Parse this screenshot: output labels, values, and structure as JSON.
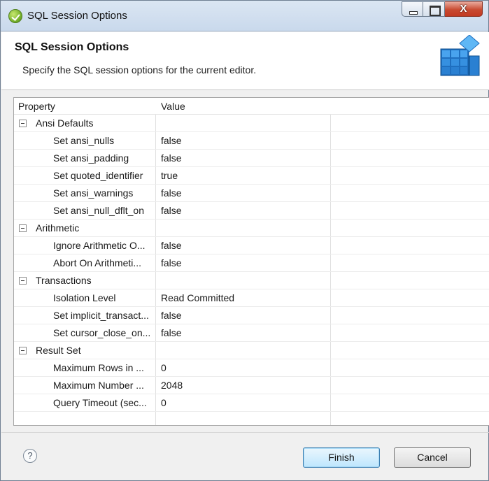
{
  "window": {
    "title": "SQL Session Options",
    "close_glyph": "X"
  },
  "header": {
    "title": "SQL Session Options",
    "description": "Specify the SQL session options for the current editor."
  },
  "table": {
    "columns": [
      "Property",
      "Value"
    ],
    "rows": [
      {
        "type": "group",
        "property": "Ansi Defaults",
        "value": ""
      },
      {
        "type": "item",
        "property": "Set ansi_nulls",
        "value": "false"
      },
      {
        "type": "item",
        "property": "Set ansi_padding",
        "value": "false"
      },
      {
        "type": "item",
        "property": "Set quoted_identifier",
        "value": "true"
      },
      {
        "type": "item",
        "property": "Set ansi_warnings",
        "value": "false"
      },
      {
        "type": "item",
        "property": "Set ansi_null_dflt_on",
        "value": "false"
      },
      {
        "type": "group",
        "property": "Arithmetic",
        "value": ""
      },
      {
        "type": "item",
        "property": "Ignore Arithmetic O...",
        "value": "false"
      },
      {
        "type": "item",
        "property": "Abort On Arithmeti...",
        "value": "false"
      },
      {
        "type": "group",
        "property": "Transactions",
        "value": ""
      },
      {
        "type": "item",
        "property": "Isolation Level",
        "value": "Read Committed"
      },
      {
        "type": "item",
        "property": "Set implicit_transact...",
        "value": "false"
      },
      {
        "type": "item",
        "property": "Set cursor_close_on...",
        "value": "false"
      },
      {
        "type": "group",
        "property": "Result Set",
        "value": ""
      },
      {
        "type": "item",
        "property": "Maximum Rows in ...",
        "value": "0"
      },
      {
        "type": "item",
        "property": "Maximum Number ...",
        "value": "2048"
      },
      {
        "type": "item",
        "property": "Query Timeout (sec...",
        "value": "0"
      }
    ]
  },
  "footer": {
    "help_glyph": "?",
    "finish_label": "Finish",
    "cancel_label": "Cancel"
  },
  "colors": {
    "accent": "#3c7fb1",
    "close_button": "#c84a31",
    "app_icon": "#7ab32e",
    "wizard_icon": "#2e86d6"
  },
  "icons": [
    "app-icon",
    "minimize-icon",
    "maximize-icon",
    "close-icon",
    "database-wizard-icon",
    "collapse-toggle-icon",
    "help-icon"
  ]
}
